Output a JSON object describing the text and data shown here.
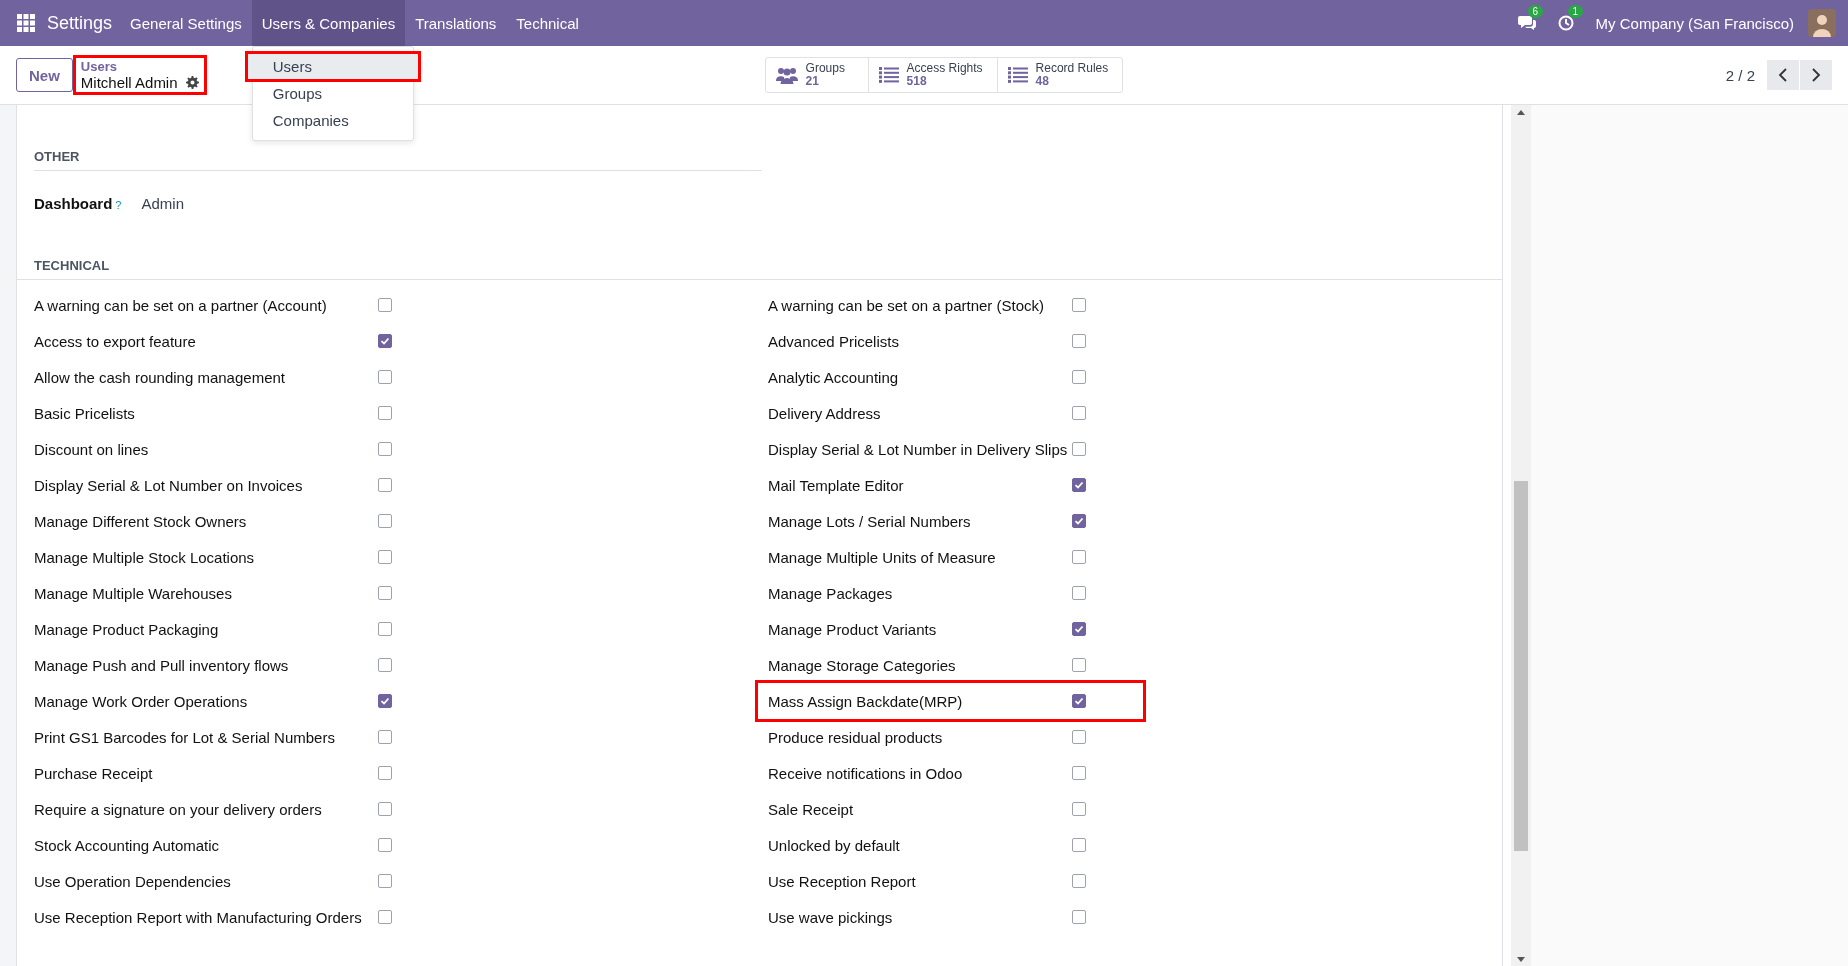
{
  "topbar": {
    "app": "Settings",
    "menus": [
      {
        "label": "General Settings",
        "selected": false
      },
      {
        "label": "Users & Companies",
        "selected": true
      },
      {
        "label": "Translations",
        "selected": false
      },
      {
        "label": "Technical",
        "selected": false
      }
    ],
    "dropdown": [
      {
        "label": "Users",
        "selected": true,
        "highlighted": true
      },
      {
        "label": "Groups",
        "selected": false,
        "highlighted": false
      },
      {
        "label": "Companies",
        "selected": false,
        "highlighted": false
      }
    ],
    "messages_badge": "6",
    "activities_badge": "1",
    "company": "My Company (San Francisco)"
  },
  "control_panel": {
    "new_button": "New",
    "breadcrumb": {
      "parent": "Users",
      "current": "Mitchell Admin",
      "highlighted": true
    },
    "stat_buttons": [
      {
        "kind": "people",
        "label": "Groups",
        "count": "21"
      },
      {
        "kind": "list",
        "label": "Access Rights",
        "count": "518"
      },
      {
        "kind": "list",
        "label": "Record Rules",
        "count": "48"
      }
    ],
    "pager": "2 / 2"
  },
  "other": {
    "title": "OTHER",
    "field": {
      "label": "Dashboard",
      "help": "?",
      "value": "Admin"
    }
  },
  "technical": {
    "title": "TECHNICAL",
    "left": [
      {
        "label": "A warning can be set on a partner (Account)",
        "checked": false,
        "highlighted": false
      },
      {
        "label": "Access to export feature",
        "checked": true,
        "highlighted": false
      },
      {
        "label": "Allow the cash rounding management",
        "checked": false,
        "highlighted": false
      },
      {
        "label": "Basic Pricelists",
        "checked": false,
        "highlighted": false
      },
      {
        "label": "Discount on lines",
        "checked": false,
        "highlighted": false
      },
      {
        "label": "Display Serial & Lot Number on Invoices",
        "checked": false,
        "highlighted": false
      },
      {
        "label": "Manage Different Stock Owners",
        "checked": false,
        "highlighted": false
      },
      {
        "label": "Manage Multiple Stock Locations",
        "checked": false,
        "highlighted": false
      },
      {
        "label": "Manage Multiple Warehouses",
        "checked": false,
        "highlighted": false
      },
      {
        "label": "Manage Product Packaging",
        "checked": false,
        "highlighted": false
      },
      {
        "label": "Manage Push and Pull inventory flows",
        "checked": false,
        "highlighted": false
      },
      {
        "label": "Manage Work Order Operations",
        "checked": true,
        "highlighted": false
      },
      {
        "label": "Print GS1 Barcodes for Lot & Serial Numbers",
        "checked": false,
        "highlighted": false
      },
      {
        "label": "Purchase Receipt",
        "checked": false,
        "highlighted": false
      },
      {
        "label": "Require a signature on your delivery orders",
        "checked": false,
        "highlighted": false
      },
      {
        "label": "Stock Accounting Automatic",
        "checked": false,
        "highlighted": false
      },
      {
        "label": "Use Operation Dependencies",
        "checked": false,
        "highlighted": false
      },
      {
        "label": "Use Reception Report with Manufacturing Orders",
        "checked": false,
        "highlighted": false
      }
    ],
    "right": [
      {
        "label": "A warning can be set on a partner (Stock)",
        "checked": false,
        "highlighted": false
      },
      {
        "label": "Advanced Pricelists",
        "checked": false,
        "highlighted": false
      },
      {
        "label": "Analytic Accounting",
        "checked": false,
        "highlighted": false
      },
      {
        "label": "Delivery Address",
        "checked": false,
        "highlighted": false
      },
      {
        "label": "Display Serial & Lot Number in Delivery Slips",
        "checked": false,
        "highlighted": false
      },
      {
        "label": "Mail Template Editor",
        "checked": true,
        "highlighted": false
      },
      {
        "label": "Manage Lots / Serial Numbers",
        "checked": true,
        "highlighted": false
      },
      {
        "label": "Manage Multiple Units of Measure",
        "checked": false,
        "highlighted": false
      },
      {
        "label": "Manage Packages",
        "checked": false,
        "highlighted": false
      },
      {
        "label": "Manage Product Variants",
        "checked": true,
        "highlighted": false
      },
      {
        "label": "Manage Storage Categories",
        "checked": false,
        "highlighted": false
      },
      {
        "label": "Mass Assign Backdate(MRP)",
        "checked": true,
        "highlighted": true
      },
      {
        "label": "Produce residual products",
        "checked": false,
        "highlighted": false
      },
      {
        "label": "Receive notifications in Odoo",
        "checked": false,
        "highlighted": false
      },
      {
        "label": "Sale Receipt",
        "checked": false,
        "highlighted": false
      },
      {
        "label": "Unlocked by default",
        "checked": false,
        "highlighted": false
      },
      {
        "label": "Use Reception Report",
        "checked": false,
        "highlighted": false
      },
      {
        "label": "Use wave pickings",
        "checked": false,
        "highlighted": false
      }
    ]
  }
}
